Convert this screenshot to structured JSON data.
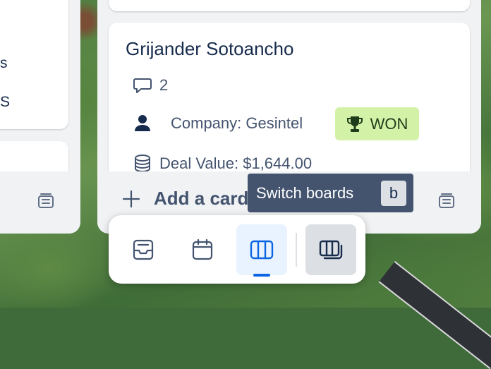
{
  "left_column": {
    "line_1": "s",
    "line_2": "S"
  },
  "card": {
    "title": "Grijander Sotoancho",
    "comment_count": "2",
    "company": "Company: Gesintel",
    "status_badge": "WON",
    "deal_value": "Deal Value: $1,644.00"
  },
  "footer": {
    "add_card_label": "Add a card"
  },
  "tooltip": {
    "label": "Switch boards",
    "shortcut": "b"
  },
  "switcher": {
    "items": [
      "inbox",
      "planner",
      "board",
      "switch-boards"
    ],
    "active": "board"
  },
  "colors": {
    "won_badge": "#d3f1a7",
    "accent": "#0c66e4",
    "tooltip": "#44546f"
  }
}
